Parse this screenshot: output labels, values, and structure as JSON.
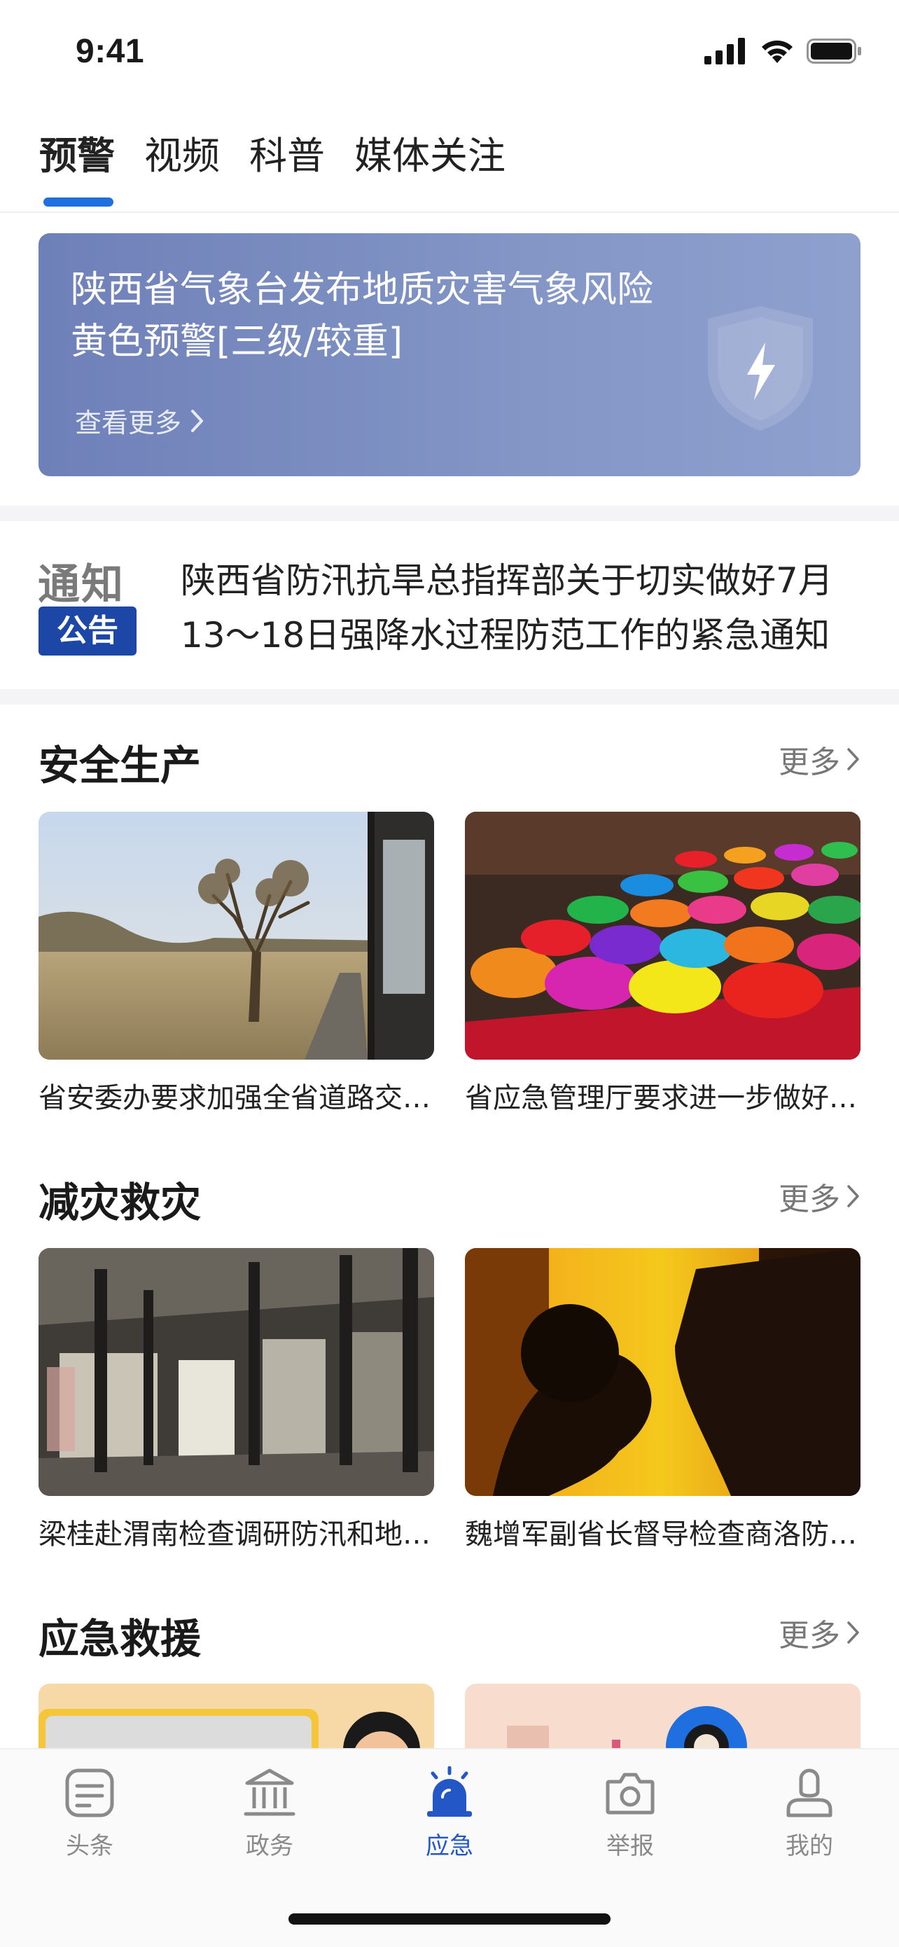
{
  "status": {
    "time": "9:41"
  },
  "tabs": [
    {
      "label": "预警",
      "active": true
    },
    {
      "label": "视频"
    },
    {
      "label": "科普"
    },
    {
      "label": "媒体关注"
    }
  ],
  "banner": {
    "title": "陕西省气象台发布地质灾害气象风险黄色预警[三级/较重]",
    "more": "查看更多",
    "icon": "shield-lightning-icon"
  },
  "notice": {
    "badge_top": "通知",
    "badge_bottom": "公告",
    "text": "陕西省防汛抗旱总指挥部关于切实做好7月13～18日强降水过程防范工作的紧急通知"
  },
  "sections": [
    {
      "title": "安全生产",
      "more": "更多",
      "cards": [
        {
          "caption": "省安委办要求加强全省道路交通安全工作",
          "image": "dry-landscape-tree"
        },
        {
          "caption": "省应急管理厅要求进一步做好安全生产工作",
          "image": "colorful-powder-market"
        }
      ]
    },
    {
      "title": "减灾救灾",
      "more": "更多",
      "cards": [
        {
          "caption": "梁桂赴渭南检查调研防汛和地质灾害防治工作",
          "image": "abandoned-warehouse"
        },
        {
          "caption": "魏增军副省长督导检查商洛防汛工作",
          "image": "makeup-portrait"
        }
      ]
    },
    {
      "title": "应急救援",
      "more": "更多",
      "cards": [
        {
          "caption": "",
          "image": "illustration-left"
        },
        {
          "caption": "",
          "image": "illustration-right"
        }
      ]
    }
  ],
  "bottom_nav": [
    {
      "label": "头条",
      "icon": "news-icon"
    },
    {
      "label": "政务",
      "icon": "government-icon"
    },
    {
      "label": "应急",
      "icon": "siren-icon",
      "active": true
    },
    {
      "label": "举报",
      "icon": "camera-icon"
    },
    {
      "label": "我的",
      "icon": "profile-icon"
    }
  ],
  "colors": {
    "accent": "#1f6fe0",
    "nav_active": "#2257c5",
    "badge": "#1d47a7",
    "banner": "#7b8ec1"
  }
}
